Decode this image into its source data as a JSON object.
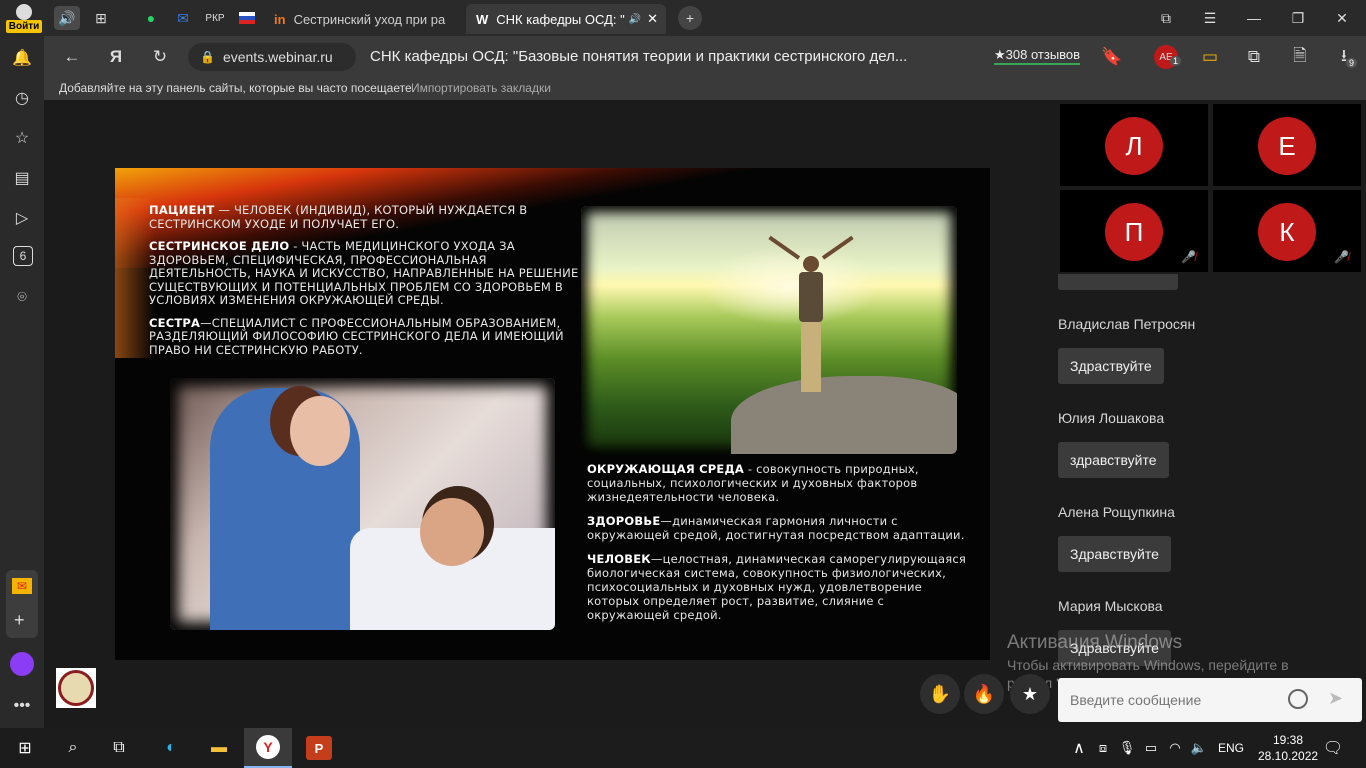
{
  "browser": {
    "login_label": "Войти",
    "tabs": [
      {
        "label": "Сестринский уход при ра",
        "favicon": "in-icon"
      },
      {
        "label": "СНК кафедры ОСД: \"",
        "favicon": "W"
      }
    ],
    "pinned_flags": [
      "РКР"
    ],
    "url": "events.webinar.ru",
    "page_title": "СНК кафедры ОСД: \"Базовые понятия теории и практики сестринского дел...",
    "reviews": "★308 отзывов",
    "downloads_count": "9",
    "badge_count": "1",
    "bookmarks_hint": "Добавляйте на эту панель сайты, которые вы часто посещаете.",
    "bookmarks_import": "Импортировать закладки",
    "sidebar_badge": "6"
  },
  "slide": {
    "block1": [
      {
        "term": "Пациент",
        "text": " — человек (индивид), который нуждается в сестринском уходе и получает его."
      },
      {
        "term": "Сестринское дело",
        "text": " - часть медицинского ухода за здоровьем, специфическая, профессиональная деятельность, наука и искусство, направленные на решение существующих и потенциальных проблем со здоровьем в условиях изменения окружающей среды."
      },
      {
        "term": "Сестра",
        "text": "—специалист с профессиональным образованием, разделяющий философию сестринского дела и имеющий право ни сестринскую работу."
      }
    ],
    "block2": [
      {
        "term": "Окружающая среда",
        "text": " - совокупность природных, социальных, психологических и духовных факторов жизнедеятельности человека."
      },
      {
        "term": "Здоровье",
        "text": "—динамическая гармония личности с окружающей средой, достигнутая посредством адаптации."
      },
      {
        "term": "Человек",
        "text": "—целостная, динамическая саморегулирующаяся биологическая система, совокупность физиологических, психосоциальных и духовных нужд, удовлетворение которых определяет рост, развитие, слияние с окружающей средой."
      }
    ]
  },
  "participants": [
    {
      "initial": "Л",
      "muted": false
    },
    {
      "initial": "Е",
      "muted": false
    },
    {
      "initial": "П",
      "muted": true
    },
    {
      "initial": "К",
      "muted": true
    }
  ],
  "chat": {
    "messages": [
      {
        "author": "Владислав Петросян",
        "text": "Здраствуйте"
      },
      {
        "author": "Юлия Лошакова",
        "text": "здравствуйте"
      },
      {
        "author": "Алена Рощупкина",
        "text": "Здравствуйте"
      },
      {
        "author": "Мария Мыскова",
        "text": "Здравствуйте"
      }
    ],
    "input_placeholder": "Введите сообщение"
  },
  "watermark": {
    "line1": "Активация Windows",
    "line2": "Чтобы активировать Windows, перейдите в",
    "line3": "раздел \"Параметры\"."
  },
  "taskbar": {
    "lang": "ENG",
    "time": "19:38",
    "date": "28.10.2022"
  },
  "colors": {
    "accent_red": "#c0191a",
    "bg": "#1b1b1b"
  }
}
